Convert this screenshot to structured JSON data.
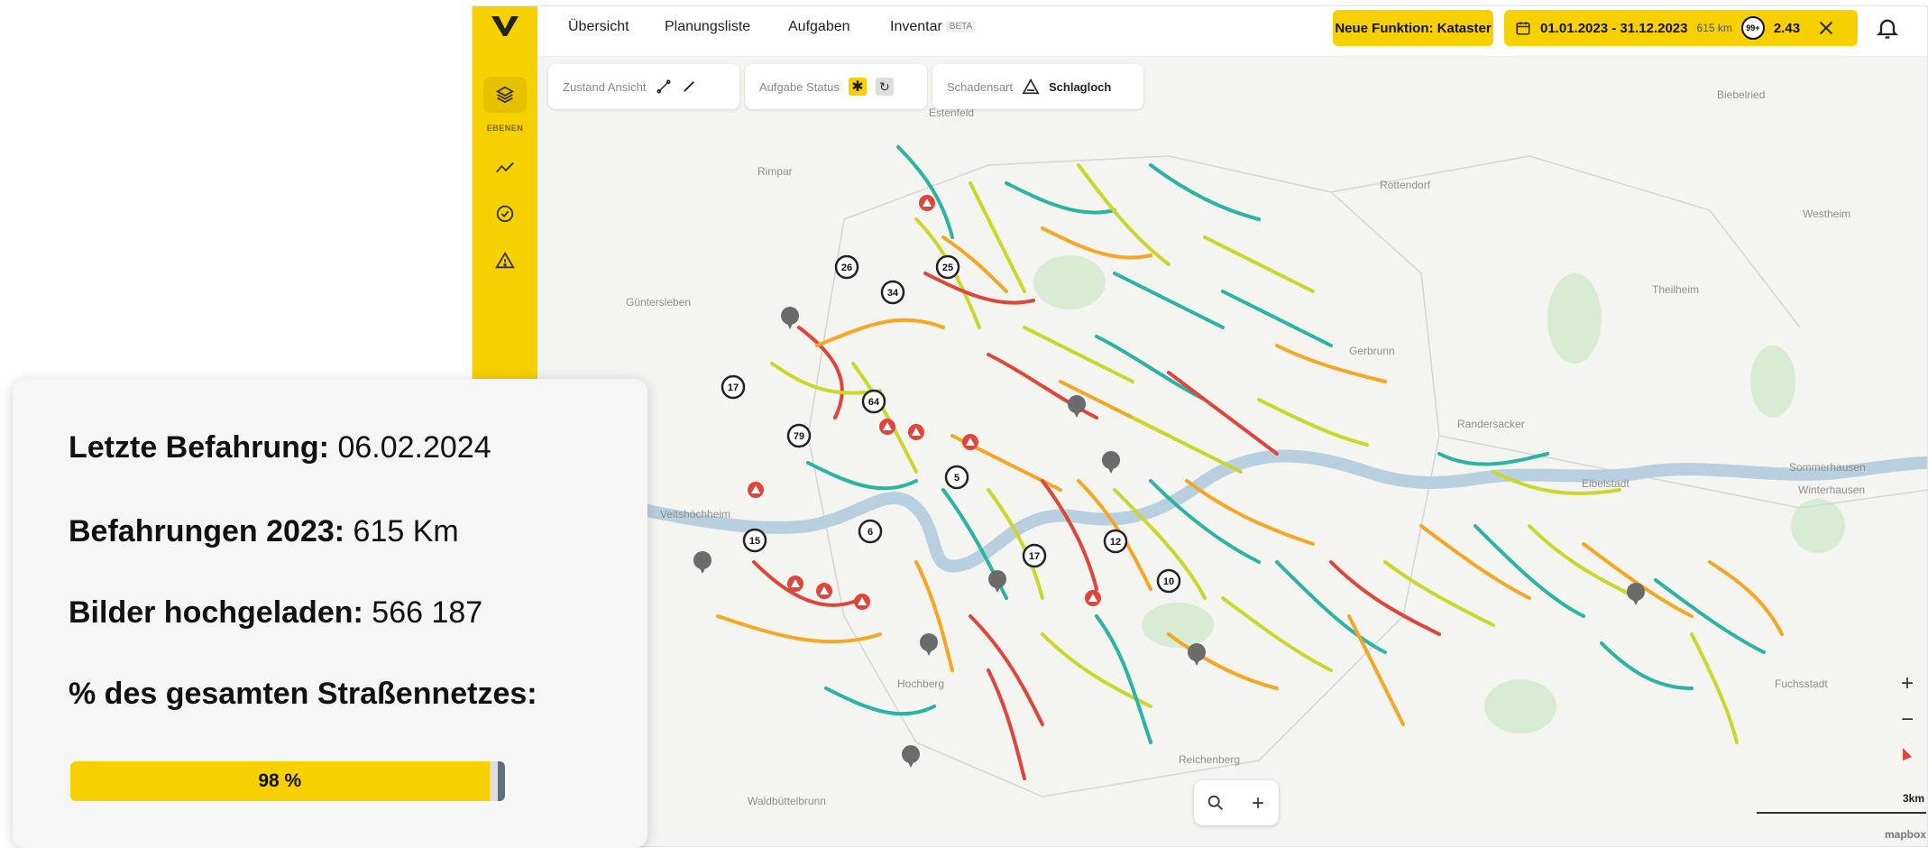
{
  "nav": {
    "items": [
      "Übersicht",
      "Planungsliste",
      "Aufgaben",
      "Inventar"
    ],
    "beta_badge": "BETA"
  },
  "sidebar": {
    "layers_label": "EBENEN",
    "icons": [
      "layers-icon",
      "trend-icon",
      "check-circle-icon",
      "warning-icon"
    ]
  },
  "header": {
    "new_feature": "Neue Funktion: Kataster",
    "date_range": "01.01.2023 - 31.12.2023",
    "km": "615 km",
    "score_badge": "99+",
    "score_value": "2.43"
  },
  "filters": {
    "zustand_label": "Zustand Ansicht",
    "aufgabe_label": "Aufgabe Status",
    "schadensart_label": "Schadensart",
    "schadensart_value": "Schlagloch"
  },
  "map": {
    "places": [
      "Rimpar",
      "Rottendorf",
      "Güntersleben",
      "Theilheim",
      "Gerbrunn",
      "Randersacker",
      "Eibelstadt",
      "Veitshöchheim",
      "Hochberg",
      "Reichenberg",
      "Waldbüttelbrunn",
      "Biebelried",
      "Sommerhausen",
      "Winterhausen",
      "Westheim",
      "Fuchsstadt",
      "Estenfeld"
    ],
    "cluster_counts": [
      "26",
      "25",
      "34",
      "17",
      "64",
      "79",
      "5",
      "15",
      "6",
      "17",
      "10",
      "12"
    ],
    "scale_label": "3km",
    "attribution": "mapbox",
    "colors": {
      "good": "#2bb3a3",
      "ok": "#c9d82b",
      "medium": "#f5a623",
      "bad": "#e0453a"
    }
  },
  "stats": {
    "last_drive_label": "Letzte Befahrung:",
    "last_drive_value": "06.02.2024",
    "drives_label": "Befahrungen 2023:",
    "drives_value": "615 Km",
    "images_label": "Bilder hochgeladen:",
    "images_value": "566 187",
    "network_label": "% des gesamten Straßennetzes:",
    "network_percent": 98,
    "network_percent_text": "98 %"
  },
  "theme": {
    "accent": "#f7d000"
  }
}
